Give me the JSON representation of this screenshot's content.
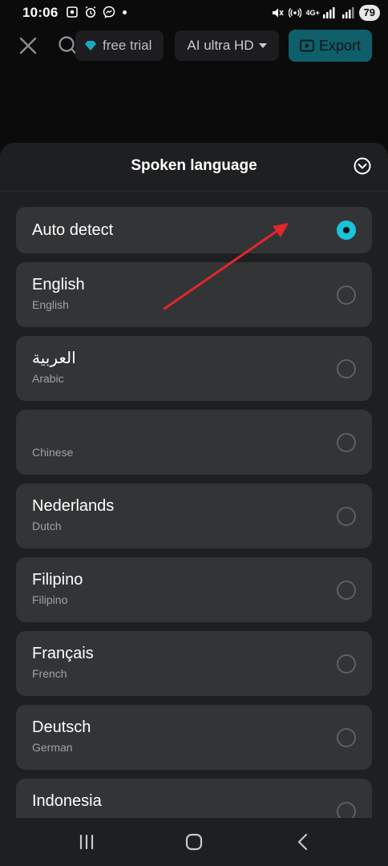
{
  "status_bar": {
    "time": "10:06",
    "battery": "79",
    "network": "4G+"
  },
  "toolbar": {
    "close_icon": "close-icon",
    "search_icon": "search-icon",
    "trial_label": "free trial",
    "quality_label": "AI ultra HD",
    "export_label": "Export"
  },
  "sheet": {
    "title": "Spoken language",
    "items": [
      {
        "native": "Auto detect",
        "english": "",
        "selected": true
      },
      {
        "native": "English",
        "english": "English",
        "selected": false
      },
      {
        "native": "العربية",
        "english": "Arabic",
        "selected": false
      },
      {
        "native": "",
        "english": "Chinese",
        "selected": false
      },
      {
        "native": "Nederlands",
        "english": "Dutch",
        "selected": false
      },
      {
        "native": "Filipino",
        "english": "Filipino",
        "selected": false
      },
      {
        "native": "Français",
        "english": "French",
        "selected": false
      },
      {
        "native": "Deutsch",
        "english": "German",
        "selected": false
      },
      {
        "native": "Indonesia",
        "english": "",
        "selected": false
      }
    ]
  },
  "colors": {
    "accent": "#19c3da",
    "export_bg": "#0e5f6a",
    "annotation_arrow": "#e3262b",
    "sheet_bg": "#1e1f21",
    "item_bg": "#333436"
  }
}
